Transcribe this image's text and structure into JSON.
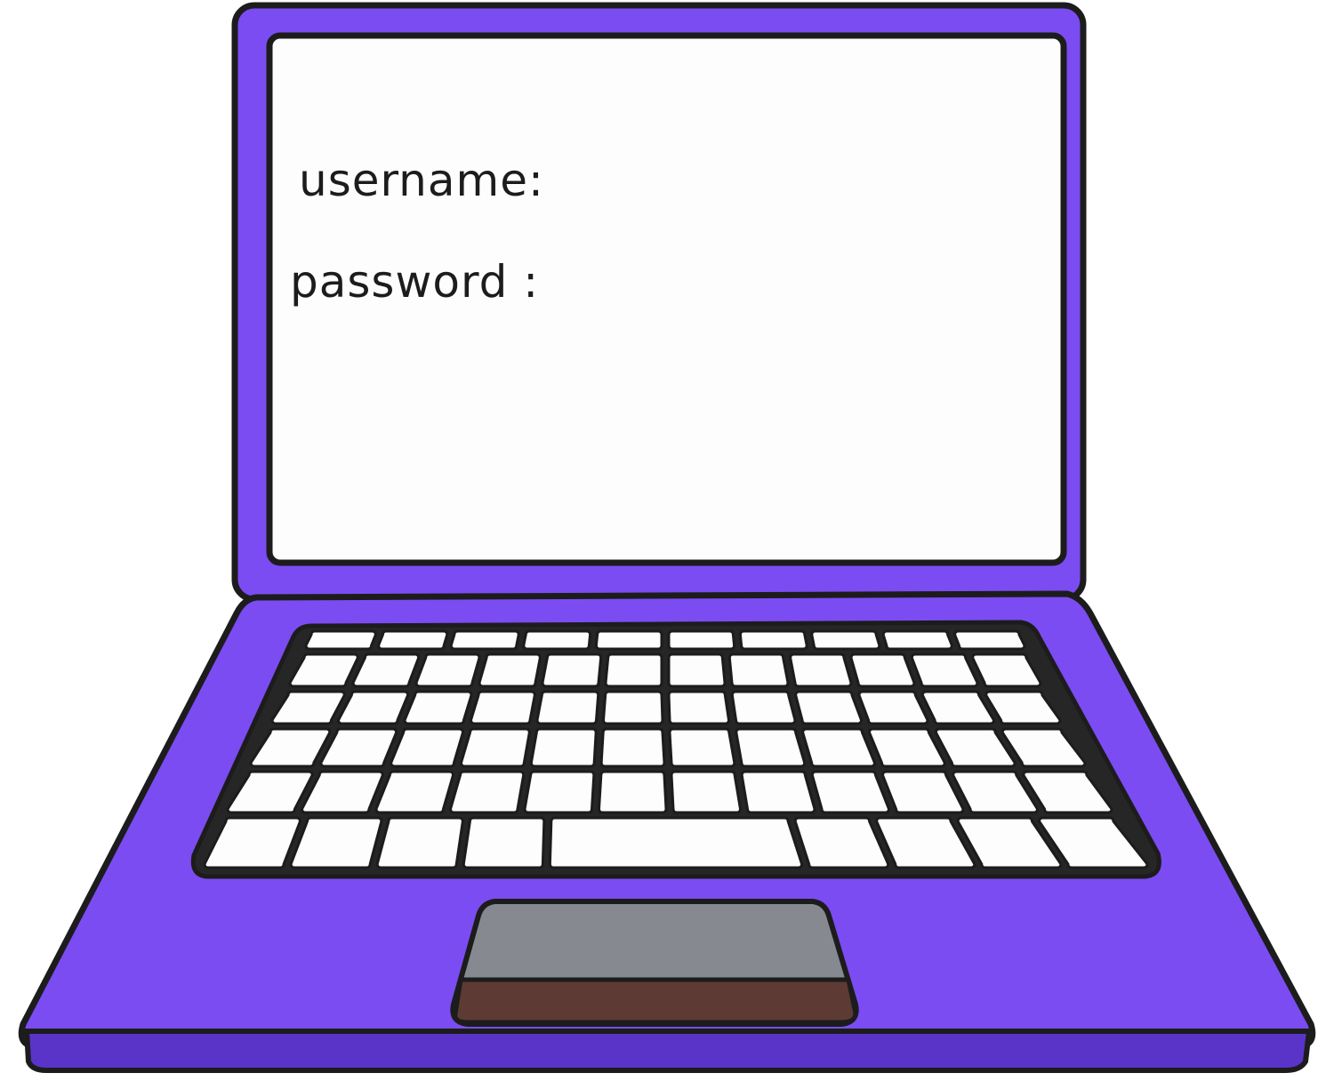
{
  "login_screen": {
    "username_label": "username:",
    "password_label": "password :"
  },
  "colors": {
    "laptop_body": "#7b4cf2",
    "laptop_body_dark": "#5a34c8",
    "outline": "#1c1c1c",
    "screen": "#fdfdfd",
    "keys": "#fdfdfd",
    "touchpad": "#868a90",
    "touchpad_edge": "#5e3a35"
  },
  "icons": {
    "laptop": "laptop-icon"
  }
}
